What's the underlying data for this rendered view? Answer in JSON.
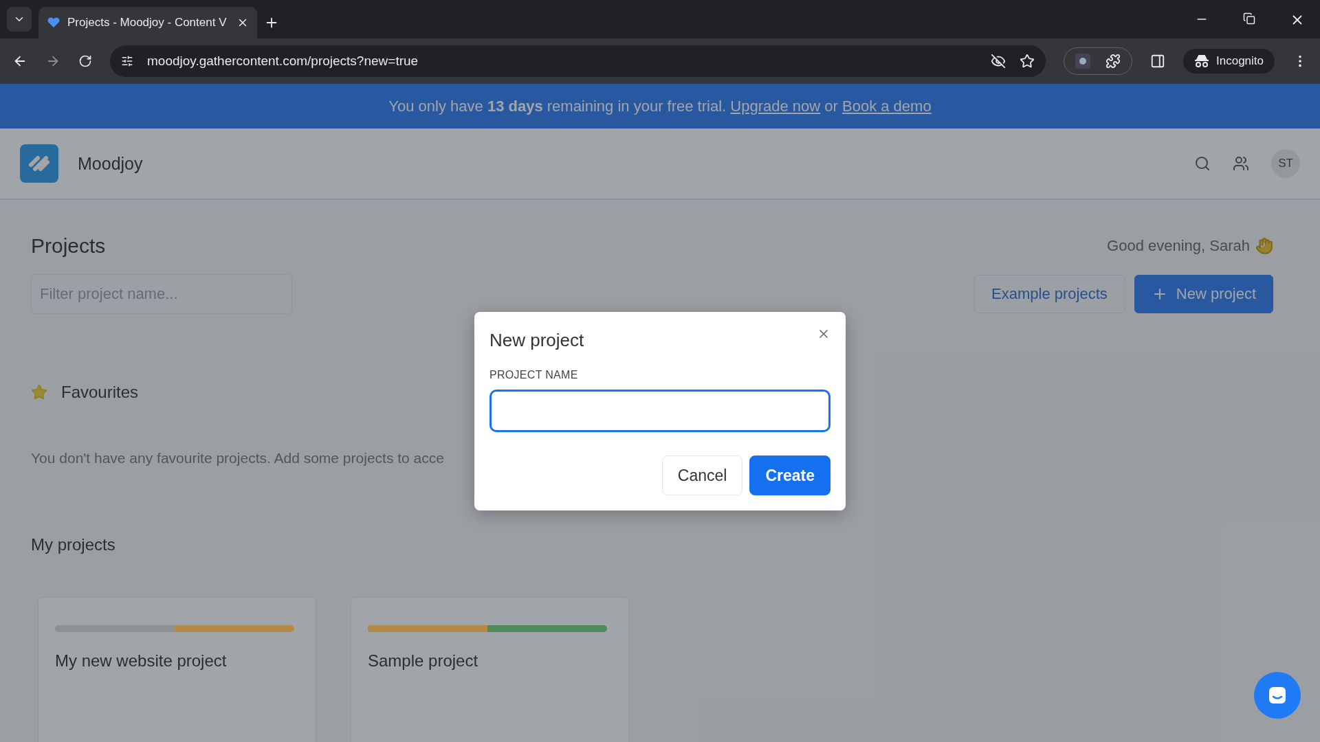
{
  "browser": {
    "tab_title": "Projects - Moodjoy - Content V",
    "url": "moodjoy.gathercontent.com/projects?new=true",
    "profile": "Incognito"
  },
  "banner": {
    "text": "You only have **13 days** remaining in your free trial.",
    "link_1": "Upgrade now",
    "joiner": "or",
    "link_2": "Book a demo"
  },
  "header": {
    "app_name": "Moodjoy",
    "avatar": "ST"
  },
  "page": {
    "title": "Projects",
    "filter": {
      "placeholder": "Filter project name..."
    },
    "greeting": "Good evening, Sarah",
    "buttons": [
      {
        "label": "Example projects",
        "kind": "secondary"
      },
      {
        "label": "New project",
        "kind": "primary"
      }
    ]
  },
  "favourites": {
    "title": "Favourites",
    "empty_text": "You don't have any favourite projects. Add some projects to acce"
  },
  "my_projects": {
    "title": "My projects",
    "cards": [
      {
        "name": "My new website project",
        "level": 0.5,
        "segments": [
          {
            "color": "#8d9196"
          },
          {
            "color": "#b58a48"
          }
        ]
      },
      {
        "name": "Sample project",
        "level": 0.5,
        "segments": [
          {
            "color": "#b58a48"
          },
          {
            "color": "#4e8a5c"
          }
        ]
      }
    ]
  },
  "modal": {
    "title": "New project",
    "field_label": "PROJECT NAME",
    "buttons": [
      {
        "label": "Cancel",
        "kind": "secondary"
      },
      {
        "label": "Create",
        "kind": "primary"
      }
    ]
  }
}
